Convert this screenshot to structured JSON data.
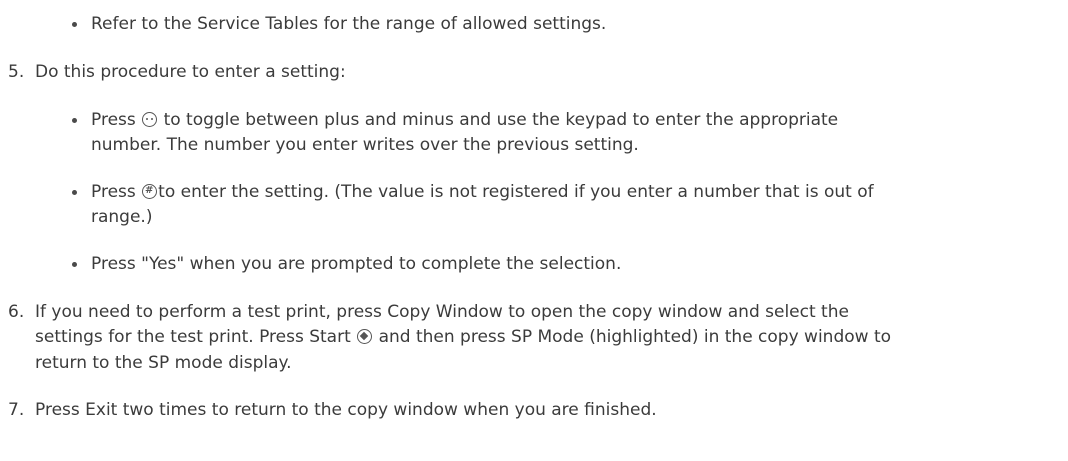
{
  "step4_bullets": {
    "b1": "Refer to the Service Tables for the range of allowed settings."
  },
  "step5": {
    "number": "5.",
    "text": "Do this procedure to enter a setting:",
    "b1_pre": "Press",
    "b1_post": "to toggle between plus and minus and use the keypad to enter the appropriate",
    "b1_line2": "number. The number you enter writes over the previous setting.",
    "b2_pre": "Press",
    "b2_post": "to enter the setting. (The value is not registered if you enter a number that is out of",
    "b2_line2": "range.)",
    "b3": "Press \"Yes\" when you are prompted to complete the selection."
  },
  "step6": {
    "number": "6.",
    "line1": "If you need to perform a test print, press Copy Window to open the copy window and select the",
    "line2_pre": "settings for the test print. Press Start",
    "line2_post": "and then press SP Mode (highlighted) in the copy window to",
    "line3": "return to the SP mode display."
  },
  "step7": {
    "number": "7.",
    "text": "Press Exit two times to return to the copy window when you are finished."
  },
  "icons": {
    "clear": "clear-modes-icon",
    "hash": "hash-key-icon",
    "hash_glyph": "#",
    "start": "start-key-icon"
  }
}
